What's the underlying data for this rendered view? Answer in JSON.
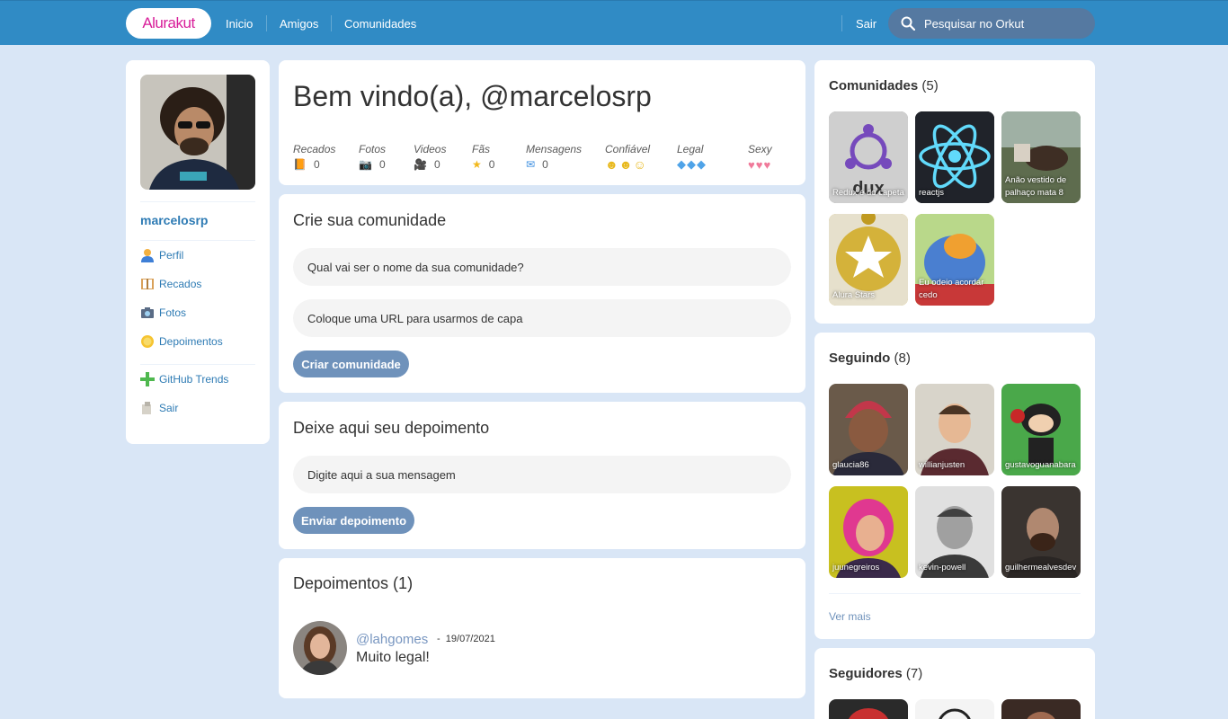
{
  "header": {
    "logo": "Alurakut",
    "nav": [
      "Inicio",
      "Amigos",
      "Comunidades"
    ],
    "logout": "Sair",
    "search_placeholder": "Pesquisar no Orkut"
  },
  "sidebar": {
    "username": "marcelosrp",
    "items": [
      {
        "label": "Perfil",
        "icon": "user-icon"
      },
      {
        "label": "Recados",
        "icon": "book-icon"
      },
      {
        "label": "Fotos",
        "icon": "camera-icon"
      },
      {
        "label": "Depoimentos",
        "icon": "sun-icon"
      },
      {
        "label": "GitHub Trends",
        "icon": "plus-icon"
      },
      {
        "label": "Sair",
        "icon": "logout-icon"
      }
    ]
  },
  "welcome": {
    "title": "Bem vindo(a), @marcelosrp",
    "stats": [
      {
        "label": "Recados",
        "value": "0",
        "icon": "book-icon"
      },
      {
        "label": "Fotos",
        "value": "0",
        "icon": "camera-icon"
      },
      {
        "label": "Videos",
        "value": "0",
        "icon": "video-camera-icon"
      },
      {
        "label": "Fãs",
        "value": "0",
        "icon": "star-icon"
      },
      {
        "label": "Mensagens",
        "value": "0",
        "icon": "envelope-icon"
      },
      {
        "label": "Confiável",
        "value": "",
        "icon": "smiley-icon"
      },
      {
        "label": "Legal",
        "value": "",
        "icon": "ice-cube-icon"
      },
      {
        "label": "Sexy",
        "value": "",
        "icon": "heart-icon"
      }
    ]
  },
  "create_community": {
    "title": "Crie sua comunidade",
    "name_placeholder": "Qual vai ser o nome da sua comunidade?",
    "url_placeholder": "Coloque uma URL para usarmos de capa",
    "button": "Criar comunidade"
  },
  "testimonial_form": {
    "title": "Deixe aqui seu depoimento",
    "placeholder": "Digite aqui a sua mensagem",
    "button": "Enviar depoimento"
  },
  "testimonials": {
    "title": "Depoimentos (1)",
    "items": [
      {
        "user": "@lahgomes",
        "date": "19/07/2021",
        "message": "Muito legal!"
      }
    ]
  },
  "communities": {
    "title": "Comunidades",
    "count": "(5)",
    "items": [
      {
        "name": "Redux é do capeta",
        "color": "#8a8a8a"
      },
      {
        "name": "reactjs",
        "color": "#222222"
      },
      {
        "name": "Anão vestido de palhaço mata 8",
        "color": "#6b7a5e"
      },
      {
        "name": "Alura Stars",
        "color": "#c9a83b"
      },
      {
        "name": "Eu odeio acordar cedo",
        "color": "#d9c24e"
      }
    ]
  },
  "following": {
    "title": "Seguindo",
    "count": "(8)",
    "items": [
      {
        "name": "glaucia86"
      },
      {
        "name": "willianjusten"
      },
      {
        "name": "gustavoguanabara"
      },
      {
        "name": "juunegreiros"
      },
      {
        "name": "kevin-powell"
      },
      {
        "name": "guilhermealvesdev"
      }
    ],
    "more": "Ver mais"
  },
  "followers": {
    "title": "Seguidores",
    "count": "(7)"
  }
}
